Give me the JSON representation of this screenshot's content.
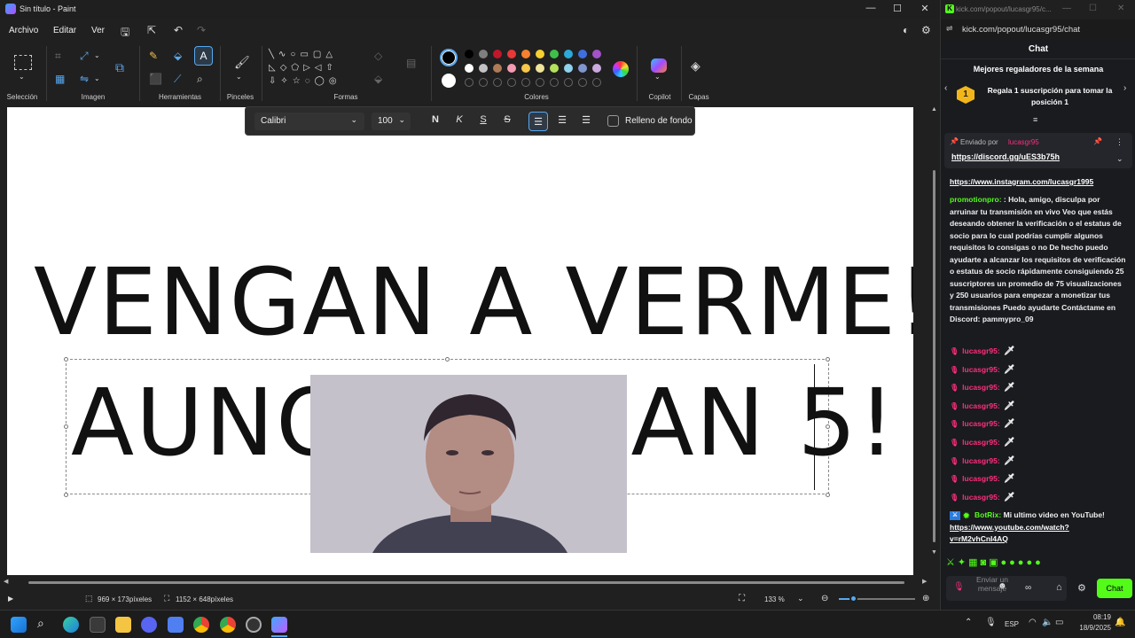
{
  "paint": {
    "title": "Sin título - Paint",
    "menus": [
      "Archivo",
      "Editar",
      "Ver"
    ],
    "groups": {
      "seleccion": "Selección",
      "imagen": "Imagen",
      "herramientas": "Herramientas",
      "pinceles": "Pinceles",
      "formas": "Formas",
      "colores": "Colores",
      "copilot": "Copilot",
      "capas": "Capas"
    },
    "palette": {
      "row1": [
        "#000000",
        "#7f7f7f",
        "#c0172b",
        "#e83838",
        "#f6812f",
        "#f5d030",
        "#3fbf4a",
        "#2ba9d9",
        "#3f6ee0",
        "#a352c9"
      ],
      "row2": [
        "#ffffff",
        "#c3c3c3",
        "#b07a57",
        "#f49bb3",
        "#f7c64a",
        "#efe49a",
        "#b3e15b",
        "#8fd3ee",
        "#7f96d1",
        "#c9a9e0"
      ],
      "primary": "#000000",
      "secondary": "#ffffff"
    },
    "textbar": {
      "font": "Calibri",
      "size": "100",
      "bold": "N",
      "italic": "K",
      "underline": "S",
      "strike": "S",
      "fill_label": "Relleno de fondo"
    },
    "canvas": {
      "line1": "VENGAN A VERME!",
      "line2": "AUNQUE SEAN 5!"
    },
    "status": {
      "selection_size": "969 × 173píxeles",
      "canvas_size": "1152 × 648píxeles",
      "zoom": "133 %"
    }
  },
  "kick": {
    "url_title": "kick.com/popout/lucasgr95/c...",
    "url": "kick.com/popout/lucasgr95/chat",
    "header": "Chat",
    "gifters_title": "Mejores regaladores de la semana",
    "gift_text": "Regala 1 suscripción para tomar la posición 1",
    "pinned_by_label": "Enviado por",
    "pinned_user": "lucasgr95",
    "pinned_link": "https://discord.gg/uES3b75h",
    "messages": [
      {
        "user": "",
        "text": "https://www.instagram.com/lucasgr1995"
      },
      {
        "user": "promotionpro:",
        "text": ": Hola, amigo, disculpa por arruinar tu transmisión en vivo Veo que estás deseando obtener la verificación o el estatus de socio para lo cual podrías cumplir algunos requisitos lo consigas o no De hecho puedo ayudarte a alcanzar los requisitos de verificación o estatus de socio rápidamente consiguiendo 25 suscriptores un promedio de 75 visualizaciones y 250 usuarios para empezar a monetizar tus transmisiones Puedo ayudarte Contáctame en Discord: pammypro_09"
      },
      {
        "user": "lucasgr95:",
        "text": ""
      },
      {
        "user": "lucasgr95:",
        "text": ""
      },
      {
        "user": "lucasgr95:",
        "text": ""
      },
      {
        "user": "lucasgr95:",
        "text": ""
      },
      {
        "user": "lucasgr95:",
        "text": ""
      },
      {
        "user": "lucasgr95:",
        "text": ""
      },
      {
        "user": "lucasgr95:",
        "text": ""
      },
      {
        "user": "lucasgr95:",
        "text": ""
      },
      {
        "user": "lucasgr95:",
        "text": ""
      }
    ],
    "botrix_user": "BotRix:",
    "botrix_text": "Mi ultimo video en YouTube!",
    "botrix_link": "https://www.youtube.com/watch?v=rM2vhCnI4AQ",
    "input_placeholder": "Enviar un mensaje",
    "chat_button": "Chat"
  },
  "taskbar": {
    "lang": "ESP",
    "time": "08:19",
    "date": "18/9/2025"
  }
}
